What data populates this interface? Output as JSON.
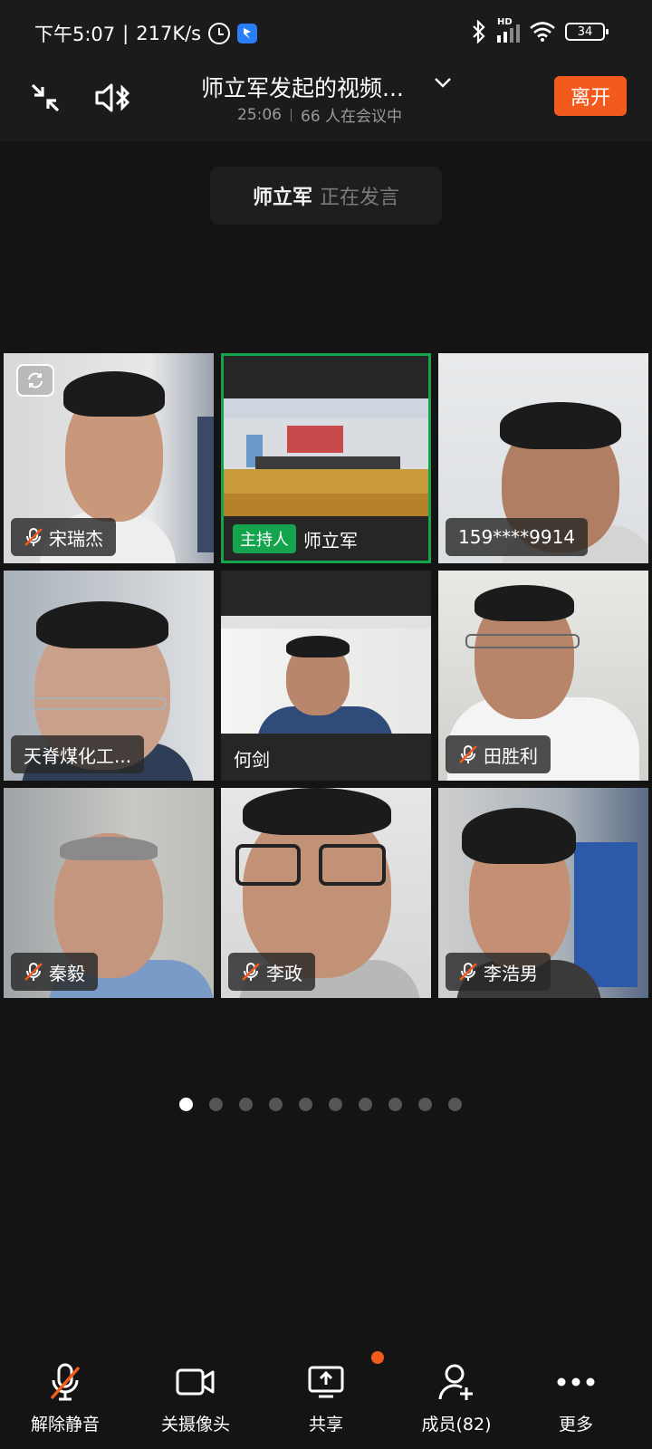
{
  "status_bar": {
    "time": "下午5:07",
    "speed": "217K/s",
    "battery": "34",
    "network": "HD"
  },
  "header": {
    "title": "师立军发起的视频...",
    "duration": "25:06",
    "participants": "66 人在会议中",
    "leave_label": "离开"
  },
  "speaking": {
    "name": "师立军",
    "status": "正在发言"
  },
  "tiles": [
    {
      "name": "宋瑞杰",
      "muted": true
    },
    {
      "name": "师立军",
      "host_label": "主持人",
      "muted": false
    },
    {
      "name": "159****9914",
      "muted": false
    },
    {
      "name": "天脊煤化工...",
      "muted": false
    },
    {
      "name": "何剑",
      "muted": false
    },
    {
      "name": "田胜利",
      "muted": true
    },
    {
      "name": "秦毅",
      "muted": true
    },
    {
      "name": "李政",
      "muted": true
    },
    {
      "name": "李浩男",
      "muted": true
    }
  ],
  "pager": {
    "total": 10,
    "current": 1
  },
  "toolbar": {
    "unmute": "解除静音",
    "camera_off": "关摄像头",
    "share": "共享",
    "members": "成员(82)",
    "more": "更多"
  },
  "colors": {
    "accent_orange": "#f25b1d",
    "host_green": "#14a44d",
    "background": "#141414"
  }
}
